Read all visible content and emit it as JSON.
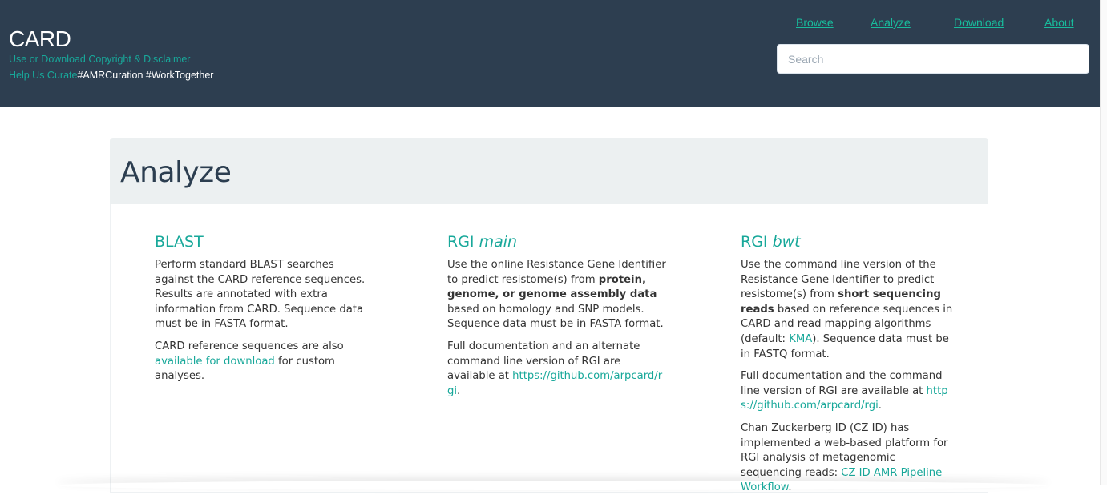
{
  "header": {
    "brand": "CARD",
    "links_line1": "Use or Download Copyright & Disclaimer",
    "help_link": "Help Us Curate",
    "hashtags": "#AMRCuration #WorkTogether",
    "nav": [
      "Browse",
      "Analyze",
      "Download",
      "About"
    ],
    "search_placeholder": "Search"
  },
  "page": {
    "title": "Analyze",
    "columns": {
      "blast": {
        "title": "BLAST",
        "p1": "Perform standard BLAST searches against the CARD reference sequences. Results are annotated with extra information from CARD. Sequence data must be in FASTA format.",
        "p2_before": "CARD reference sequences are also",
        "p2_link": "available for download",
        "p2_after": "for custom analyses."
      },
      "rgi_main": {
        "title_prefix": "RGI",
        "title_em": "main",
        "p1_before": "Use the online Resistance Gene Identifier to predict resistome(s) from",
        "p1_bold": "protein, genome, or genome assembly data",
        "p1_after": "based on homology and SNP models. Sequence data must be in FASTA format.",
        "p2_before": "Full documentation and an alternate command line version of RGI are available at",
        "p2_link": "https://github.com/arpcard/rgi",
        "p2_after": "."
      },
      "rgi_bwt": {
        "title_prefix": "RGI",
        "title_em": "bwt",
        "p1_before": "Use the command line version of the Resistance Gene Identifier to predict resistome(s) from",
        "p1_bold": "short sequencing reads",
        "p1_mid": "based on reference sequences in CARD and read mapping algorithms (default:",
        "p1_link": "KMA",
        "p1_after": "). Sequence data must be in FASTQ format.",
        "p2_before": "Full documentation and the command line version of RGI are available at",
        "p2_link": "https://github.com/arpcard/rgi",
        "p2_after": ".",
        "p3_before": "Chan Zuckerberg ID (CZ ID) has implemented a web-based platform for RGI analysis of metagenomic sequencing reads:",
        "p3_link": "CZ ID AMR Pipeline Workflow",
        "p3_after": "."
      }
    }
  },
  "colors": {
    "navbar": "#2d3e50",
    "accent": "#18bc9c",
    "jumbotron": "#ecf0f1"
  }
}
